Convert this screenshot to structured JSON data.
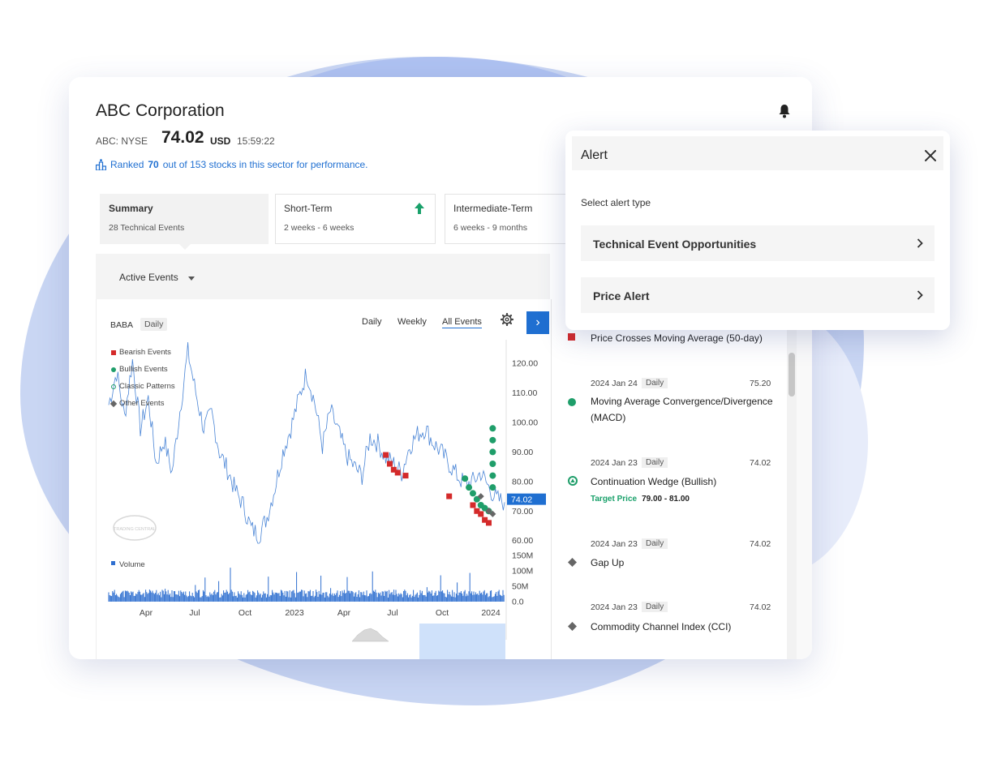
{
  "company": {
    "name": "ABC Corporation"
  },
  "quote": {
    "exchange": "ABC: NYSE",
    "price": "74.02",
    "currency": "USD",
    "time": "15:59:22"
  },
  "ranking": {
    "prefix": "Ranked",
    "rank": "70",
    "suffix": "out of 153 stocks in this sector for performance."
  },
  "tabs": [
    {
      "title": "Summary",
      "subtitle": "28 Technical Events",
      "selected": true
    },
    {
      "title": "Short-Term",
      "subtitle": "2 weeks - 6 weeks",
      "trend_icon": "arrow-up-icon",
      "trend_color": "#1aa16b"
    },
    {
      "title": "Intermediate-Term",
      "subtitle": "6 weeks - 9 months"
    }
  ],
  "events_filter": {
    "label": "Active Events"
  },
  "chart_toolbar": {
    "symbol": "BABA",
    "interval": "Daily",
    "periods": [
      "Daily",
      "Weekly",
      "All Events"
    ],
    "active_period": "All Events",
    "next_label": "›"
  },
  "chart_data": {
    "type": "line",
    "series_name": "",
    "price_axis": {
      "ticks": [
        "120.00",
        "110.00",
        "100.00",
        "90.00",
        "80.00",
        "70.00",
        "60.00"
      ],
      "ylim": [
        58,
        128
      ]
    },
    "volume_axis": {
      "ticks": [
        "150M",
        "100M",
        "50M",
        "0.0"
      ],
      "label": "Volume"
    },
    "x_ticks": [
      "Apr",
      "Jul",
      "Oct",
      "2023",
      "Apr",
      "Jul",
      "Oct",
      "2024"
    ],
    "current_price": "74.02",
    "legend": [
      {
        "label": "Bearish Events",
        "color": "#d42a2a",
        "shape": "square"
      },
      {
        "label": "Bullish Events",
        "color": "#1f9e6a",
        "shape": "circle"
      },
      {
        "label": "Classic Patterns",
        "color": "#1f9e6a",
        "shape": "ring"
      },
      {
        "label": "Other Events",
        "color": "#666666",
        "shape": "diamond"
      }
    ],
    "price_points": [
      [
        0,
        106
      ],
      [
        2,
        117
      ],
      [
        4,
        102
      ],
      [
        6,
        121
      ],
      [
        8,
        98
      ],
      [
        10,
        108
      ],
      [
        12,
        86
      ],
      [
        14,
        94
      ],
      [
        16,
        83
      ],
      [
        18,
        104
      ],
      [
        20,
        124
      ],
      [
        22,
        110
      ],
      [
        24,
        98
      ],
      [
        26,
        103
      ],
      [
        28,
        90
      ],
      [
        30,
        84
      ],
      [
        32,
        77
      ],
      [
        34,
        72
      ],
      [
        36,
        64
      ],
      [
        38,
        62
      ],
      [
        40,
        68
      ],
      [
        42,
        78
      ],
      [
        44,
        90
      ],
      [
        46,
        98
      ],
      [
        48,
        108
      ],
      [
        50,
        117
      ],
      [
        52,
        107
      ],
      [
        54,
        92
      ],
      [
        56,
        104
      ],
      [
        58,
        97
      ],
      [
        60,
        89
      ],
      [
        62,
        85
      ],
      [
        64,
        82
      ],
      [
        66,
        95
      ],
      [
        68,
        93
      ],
      [
        70,
        88
      ],
      [
        72,
        86
      ],
      [
        74,
        83
      ],
      [
        76,
        92
      ],
      [
        78,
        96
      ],
      [
        80,
        98
      ],
      [
        82,
        93
      ],
      [
        84,
        90
      ],
      [
        86,
        86
      ],
      [
        88,
        82
      ],
      [
        90,
        79
      ],
      [
        92,
        80
      ],
      [
        94,
        83
      ],
      [
        96,
        78
      ],
      [
        98,
        74
      ],
      [
        100,
        73
      ]
    ],
    "bearish_events": [
      [
        70,
        89
      ],
      [
        71,
        86
      ],
      [
        72,
        84
      ],
      [
        73,
        83
      ],
      [
        75,
        82
      ],
      [
        86,
        75
      ],
      [
        92,
        72
      ],
      [
        93,
        70
      ],
      [
        94,
        69
      ],
      [
        95,
        67
      ],
      [
        96,
        66
      ]
    ],
    "bullish_events": [
      [
        97,
        98
      ],
      [
        97,
        94
      ],
      [
        97,
        90
      ],
      [
        97,
        86
      ],
      [
        97,
        82
      ],
      [
        97,
        78
      ],
      [
        90,
        81
      ],
      [
        91,
        78
      ],
      [
        92,
        76
      ],
      [
        93,
        74
      ],
      [
        94,
        72
      ],
      [
        95,
        71
      ],
      [
        96,
        70
      ]
    ],
    "other_events": [
      [
        94,
        75
      ],
      [
        96,
        70
      ],
      [
        97,
        69
      ]
    ]
  },
  "event_list": [
    {
      "name": "Price Crosses Moving Average (50-day)",
      "marker": "bearish"
    },
    {
      "date": "2024 Jan 24",
      "interval": "Daily",
      "value": "75.20",
      "name": "Moving Average Convergence/Divergence (MACD)",
      "marker": "bullish"
    },
    {
      "date": "2024 Jan 23",
      "interval": "Daily",
      "value": "74.02",
      "name": "Continuation Wedge (Bullish)",
      "marker": "pattern",
      "target_label": "Target Price",
      "target_range": "79.00 - 81.00"
    },
    {
      "date": "2024 Jan 23",
      "interval": "Daily",
      "value": "74.02",
      "name": "Gap Up",
      "marker": "other"
    },
    {
      "date": "2024 Jan 23",
      "interval": "Daily",
      "value": "74.02",
      "name": "Commodity Channel Index (CCI)",
      "marker": "other"
    }
  ],
  "alert_dialog": {
    "title": "Alert",
    "subtitle": "Select alert type",
    "options": [
      "Technical Event Opportunities",
      "Price Alert"
    ]
  },
  "colors": {
    "accent": "#1f6fd1",
    "bearish": "#d42a2a",
    "bullish": "#1f9e6a",
    "other": "#666666",
    "line": "#4a85d6",
    "volume": "#2f6fd0"
  },
  "watermark": "TRADING CENTRAL"
}
